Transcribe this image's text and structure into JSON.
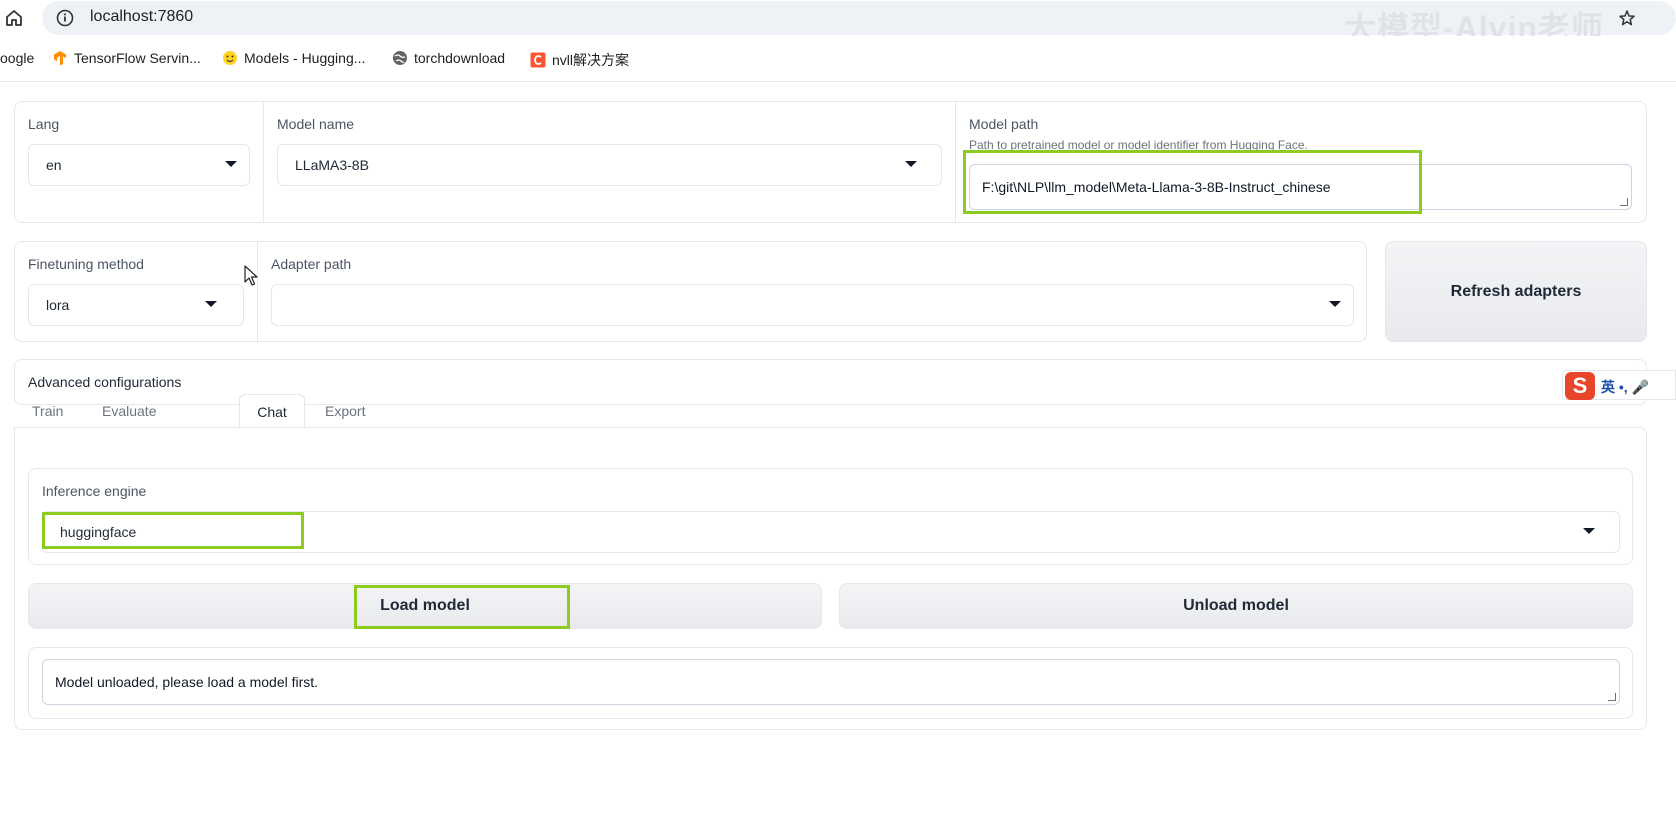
{
  "browser": {
    "url": "localhost:7860",
    "watermark": "大模型-Alvin老师",
    "bookmarks": [
      {
        "label": "oogle",
        "icon": "none"
      },
      {
        "label": "TensorFlow Servin...",
        "icon": "tensorflow-icon"
      },
      {
        "label": "Models - Hugging...",
        "icon": "huggingface-icon"
      },
      {
        "label": "torchdownload",
        "icon": "globe-icon"
      },
      {
        "label": "nvll解决方案",
        "icon": "csdn-icon"
      }
    ]
  },
  "model": {
    "lang_label": "Lang",
    "lang_value": "en",
    "model_name_label": "Model name",
    "model_name_value": "LLaMA3-8B",
    "model_path_label": "Model path",
    "model_path_hint": "Path to pretrained model or model identifier from Hugging Face.",
    "model_path_value": "F:\\git\\NLP\\llm_model\\Meta-Llama-3-8B-Instruct_chinese"
  },
  "finetune": {
    "method_label": "Finetuning method",
    "method_value": "lora",
    "adapter_label": "Adapter path",
    "adapter_value": "",
    "refresh_label": "Refresh adapters"
  },
  "advanced": {
    "label": "Advanced configurations"
  },
  "tabs": [
    {
      "label": "Train",
      "active": false
    },
    {
      "label": "Evaluate & Predict",
      "active": false
    },
    {
      "label": "Chat",
      "active": true
    },
    {
      "label": "Export",
      "active": false
    }
  ],
  "chat": {
    "engine_label": "Inference engine",
    "engine_value": "huggingface",
    "load_label": "Load model",
    "unload_label": "Unload model",
    "status_text": "Model unloaded, please load a model first."
  },
  "ime": {
    "logo": "S",
    "text": "英 •, 🎤"
  },
  "colors": {
    "highlight": "#8ccc21",
    "ime_brand": "#e7462b"
  }
}
